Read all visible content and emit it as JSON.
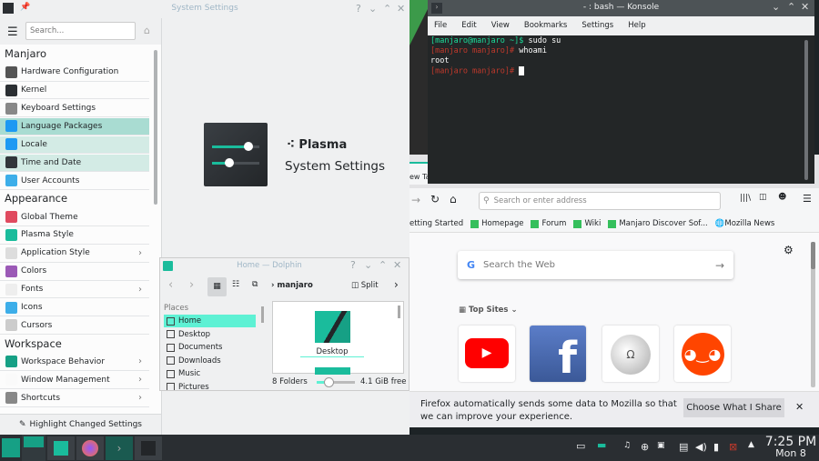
{
  "settings": {
    "title": "System Settings",
    "search_placeholder": "Search...",
    "groups": [
      {
        "heading": "Manjaro",
        "items": [
          {
            "label": "Hardware Configuration",
            "color": "#555"
          },
          {
            "label": "Kernel",
            "color": "#2b2f33"
          },
          {
            "label": "Keyboard Settings",
            "color": "#888"
          },
          {
            "label": "Language Packages",
            "color": "#1d99f3",
            "state": "selected"
          },
          {
            "label": "Locale",
            "color": "#1d99f3",
            "state": "hover"
          },
          {
            "label": "Time and Date",
            "color": "#31363b",
            "state": "hover"
          },
          {
            "label": "User Accounts",
            "color": "#3daee9"
          }
        ]
      },
      {
        "heading": "Appearance",
        "items": [
          {
            "label": "Global Theme",
            "color": "#e04a5f"
          },
          {
            "label": "Plasma Style",
            "color": "#1abc9c"
          },
          {
            "label": "Application Style",
            "color": "#ddd",
            "chevron": true
          },
          {
            "label": "Colors",
            "color": "#9b59b6"
          },
          {
            "label": "Fonts",
            "color": "#eee",
            "chevron": true
          },
          {
            "label": "Icons",
            "color": "#3daee9"
          },
          {
            "label": "Cursors",
            "color": "#ccc"
          }
        ]
      },
      {
        "heading": "Workspace",
        "items": [
          {
            "label": "Workspace Behavior",
            "color": "#16a085",
            "chevron": true
          },
          {
            "label": "Window Management",
            "color": "#fafafa",
            "chevron": true
          },
          {
            "label": "Shortcuts",
            "color": "#888",
            "chevron": true
          }
        ]
      }
    ],
    "highlight_button": "Highlight Changed Settings",
    "brand": "Plasma",
    "subtitle": "System Settings"
  },
  "dolphin": {
    "title": "Home — Dolphin",
    "breadcrumb": "manjaro",
    "split": "Split",
    "places_label": "Places",
    "places": [
      {
        "label": "Home",
        "selected": true
      },
      {
        "label": "Desktop"
      },
      {
        "label": "Documents"
      },
      {
        "label": "Downloads"
      },
      {
        "label": "Music"
      },
      {
        "label": "Pictures"
      }
    ],
    "file": "Desktop",
    "status": "8 Folders",
    "free": "4.1 GiB free",
    "zoom_level": 0.3
  },
  "konsole": {
    "title": "- : bash — Konsole",
    "menu": [
      "File",
      "Edit",
      "View",
      "Bookmarks",
      "Settings",
      "Help"
    ],
    "lines": [
      {
        "prompt": "[manjaro@manjaro ~]$",
        "cmd": " sudo su",
        "type": "user"
      },
      {
        "prompt": "[manjaro manjaro]#",
        "cmd": " whoami",
        "type": "root"
      },
      {
        "prompt": "",
        "cmd": "root",
        "type": "out"
      },
      {
        "prompt": "[manjaro manjaro]#",
        "cmd": " ",
        "type": "root"
      }
    ]
  },
  "firefox": {
    "tab": "ew Ta",
    "address_placeholder": "Search or enter address",
    "bookmarks": [
      "etting Started",
      "Homepage",
      "Forum",
      "Wiki",
      "Manjaro Discover Sof...",
      "Mozilla News"
    ],
    "search_placeholder": "Search the Web",
    "top_sites": "Top Sites",
    "sites": [
      "youtube",
      "facebook",
      "wikipedia",
      "reddit"
    ],
    "notice_line1": "Firefox automatically sends some data to Mozilla so that",
    "notice_line2": "we can improve your experience.",
    "notice_button": "Choose What I Share"
  },
  "taskbar": {
    "time": "7:25 PM",
    "date": "Mon 8",
    "accent": "#16a085"
  }
}
